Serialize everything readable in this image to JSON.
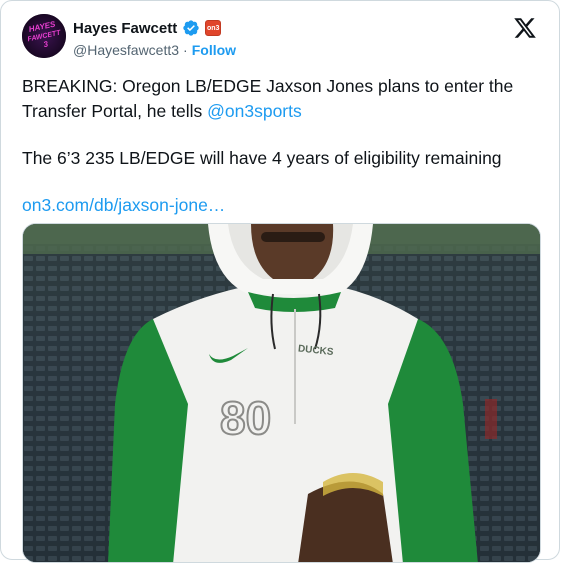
{
  "author": {
    "display_name": "Hayes Fawcett",
    "handle": "@Hayesfawcett3",
    "separator": "·",
    "follow_label": "Follow",
    "avatar_text": [
      "HAYES",
      "FAWCETT",
      "3"
    ],
    "affiliate_badge": "on3"
  },
  "tweet": {
    "line1_prefix": "BREAKING: Oregon LB/EDGE Jaxson Jones plans to enter the Transfer Portal, he tells ",
    "mention": "@on3sports",
    "line2": "The 6’3 235 LB/EDGE will have 4 years of eligibility remaining",
    "link": "on3.com/db/jaxson-jone…"
  },
  "media": {
    "jersey_number": "80",
    "chest_text": "DUCKS"
  },
  "colors": {
    "accent": "#1d9bf0",
    "text": "#0f1419",
    "muted": "#536471",
    "oregon_green": "#1f8a3a"
  },
  "icons": {
    "verified": "verified-badge-icon",
    "x": "x-logo-icon",
    "swoosh": "nike-swoosh-icon"
  }
}
